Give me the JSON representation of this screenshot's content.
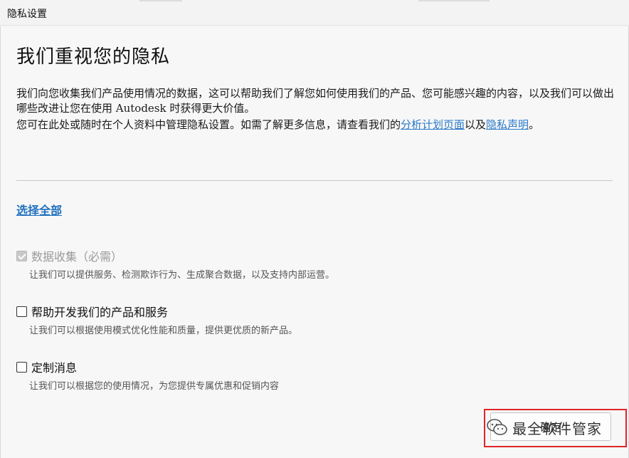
{
  "window": {
    "title": "隐私设置"
  },
  "main": {
    "heading": "我们重视您的隐私",
    "para1": "我们向您收集我们产品使用情况的数据，这可以帮助我们了解您如何使用我们的产品、您可能感兴趣的内容，以及我们可以做出哪些改进让您在使用 Autodesk 时获得更大价值。",
    "para2_prefix": "您可在此处或随时在个人资料中管理隐私设置。如需了解更多信息，请查看我们的",
    "link_analytics": "分析计划页面",
    "para2_middle": "以及",
    "link_privacy": "隐私声明",
    "para2_suffix": "。",
    "select_all": "选择全部"
  },
  "options": [
    {
      "label": "数据收集（必需）",
      "desc": "让我们可以提供服务、检测欺诈行为、生成聚合数据，以及支持内部运营。",
      "checked": true,
      "disabled": true
    },
    {
      "label": "帮助开发我们的产品和服务",
      "desc": "让我们可以根据使用模式优化性能和质量，提供更优质的新产品。",
      "checked": false,
      "disabled": false
    },
    {
      "label": "定制消息",
      "desc": "让我们可以根据您的使用情况，为您提供专属优惠和促销内容",
      "checked": false,
      "disabled": false
    }
  ],
  "footer": {
    "ok_label": "确定",
    "watermark_text": "最全软件管家"
  },
  "colors": {
    "link": "#2a79c8",
    "highlight": "#e0262b"
  }
}
